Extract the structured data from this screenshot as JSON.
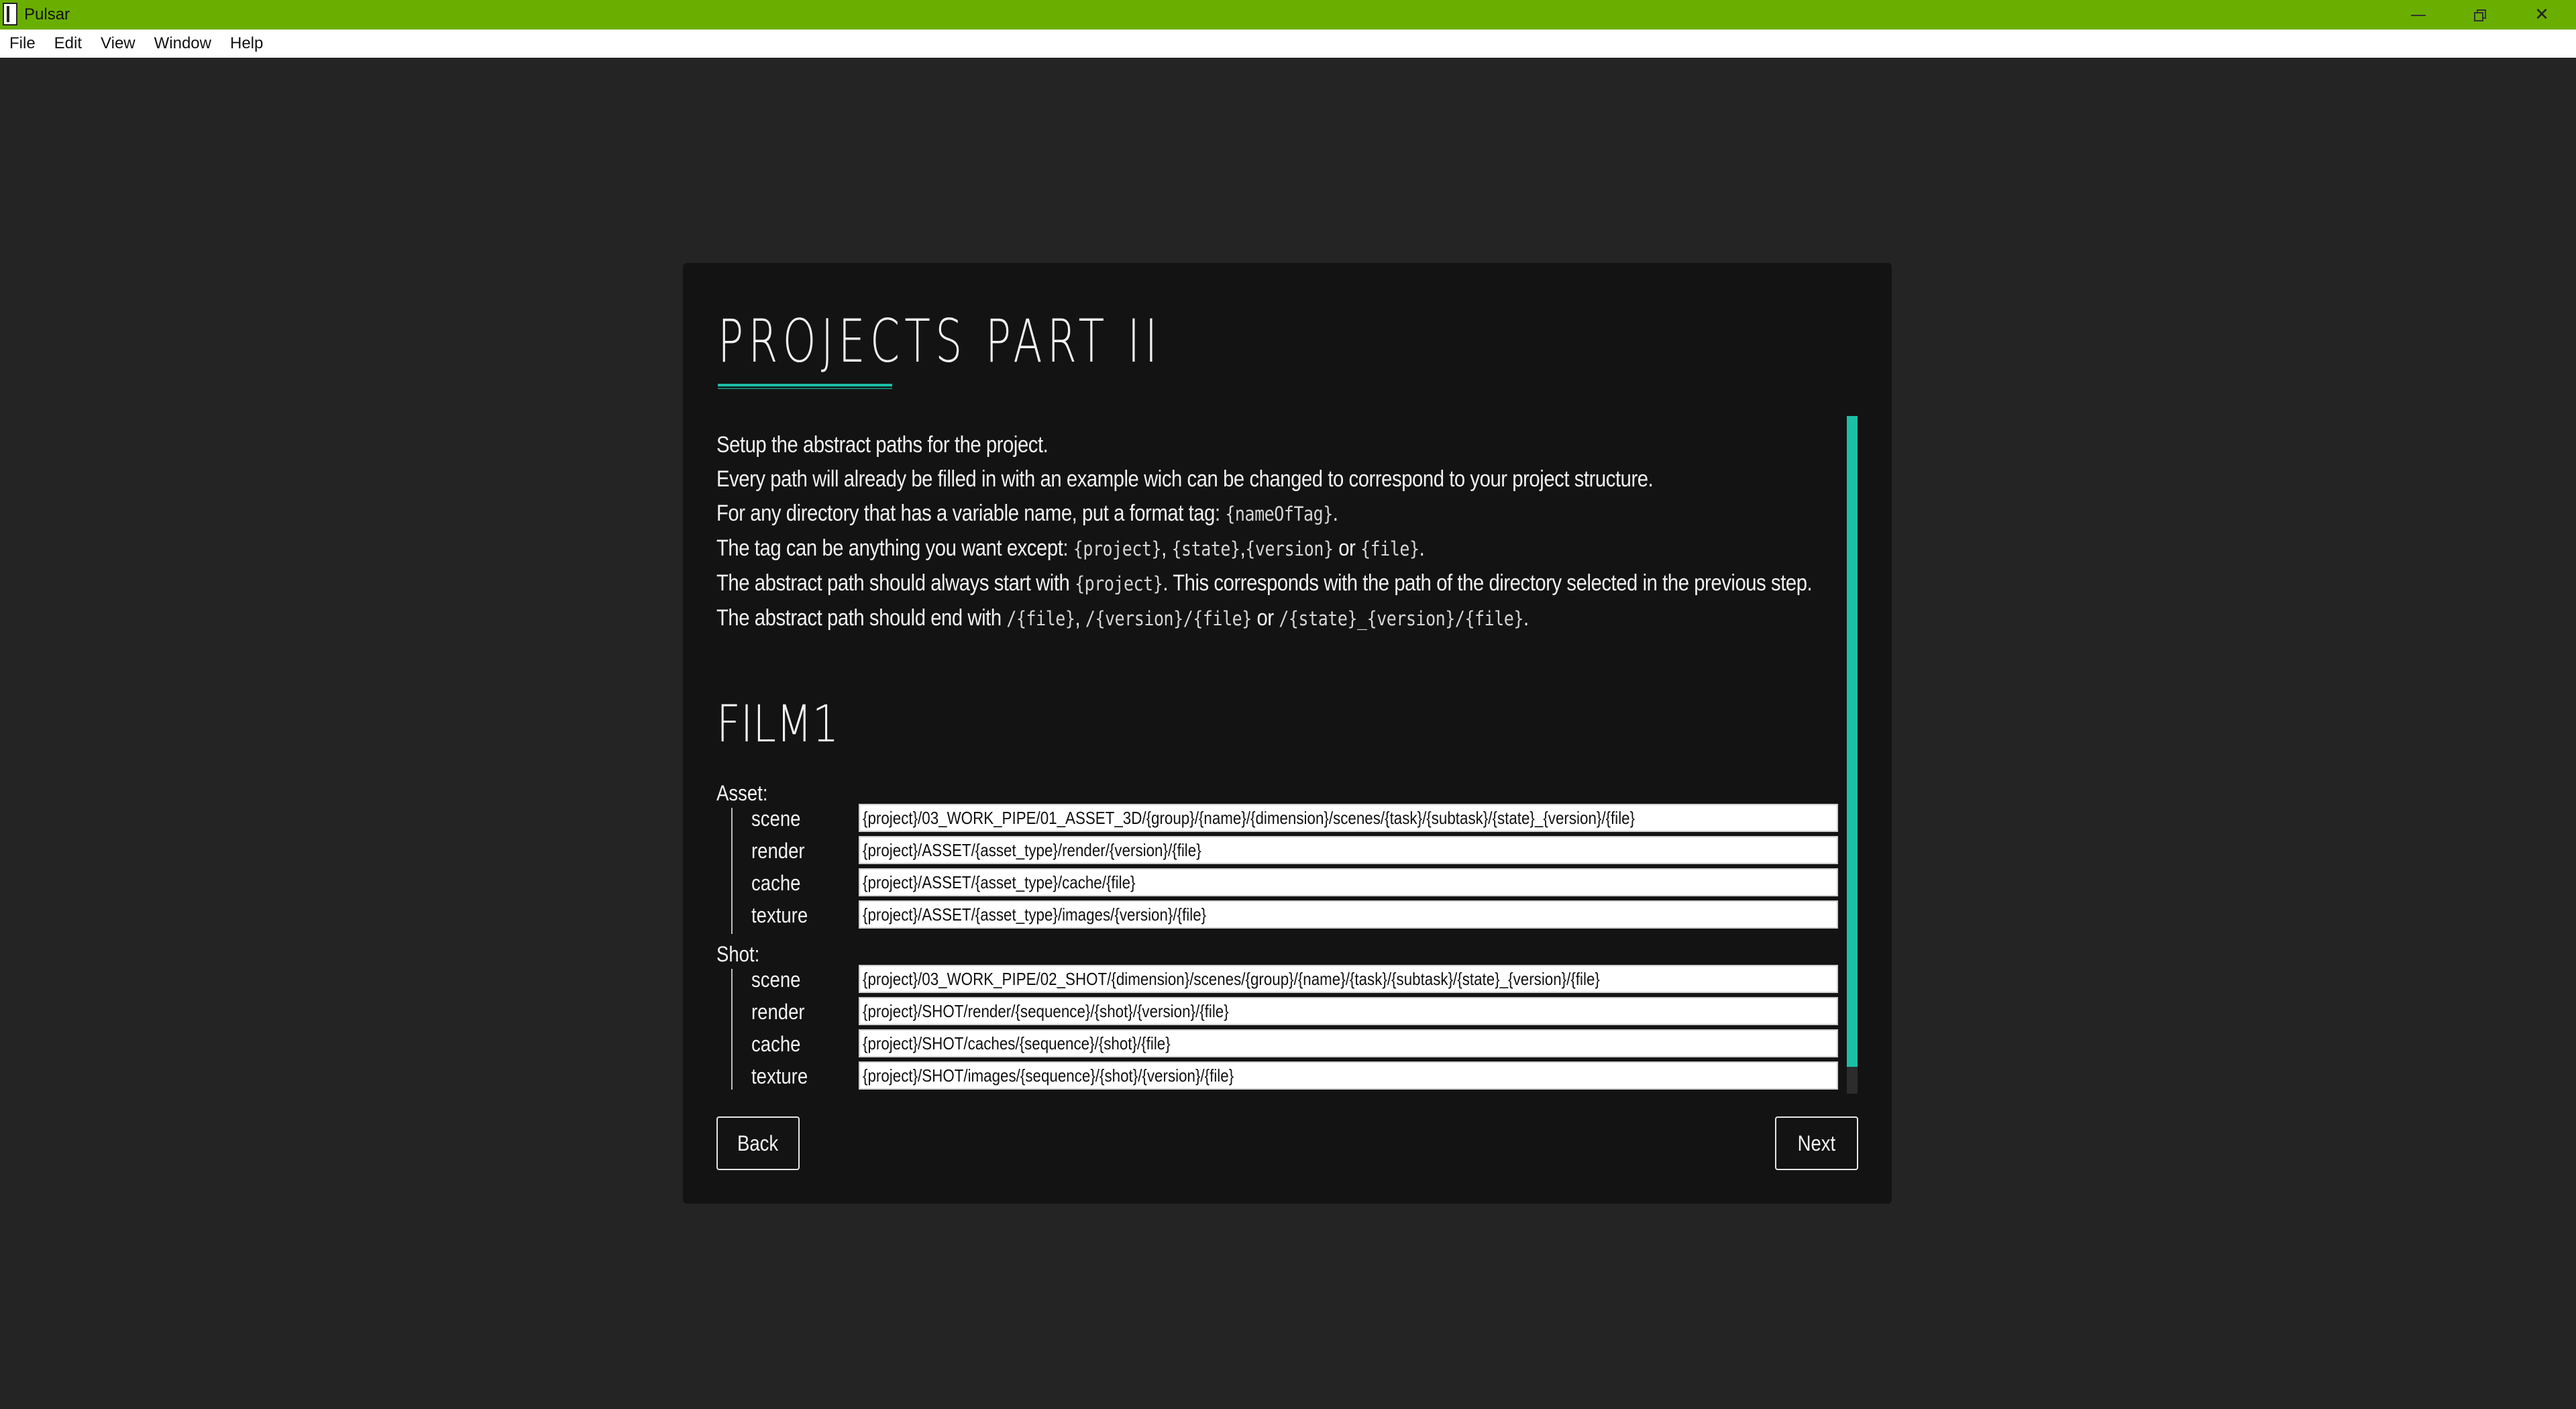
{
  "window": {
    "title": "Pulsar",
    "minimize": "",
    "maximize": "",
    "close": "✕"
  },
  "menu": [
    "File",
    "Edit",
    "View",
    "Window",
    "Help"
  ],
  "dialog": {
    "heading": "PROJECTS PART II",
    "description": [
      [
        {
          "t": "Setup the abstract paths for the project."
        }
      ],
      [
        {
          "t": "Every path will already be filled in with an example wich can be changed to correspond to your project structure."
        }
      ],
      [
        {
          "t": "For any directory that has a variable name, put a format tag: "
        },
        {
          "t": "{nameOfTag}",
          "m": true
        },
        {
          "t": "."
        }
      ],
      [
        {
          "t": "The tag can be anything you want except: "
        },
        {
          "t": "{project}",
          "m": true
        },
        {
          "t": ", "
        },
        {
          "t": "{state}",
          "m": true
        },
        {
          "t": ","
        },
        {
          "t": "{version}",
          "m": true
        },
        {
          "t": " or "
        },
        {
          "t": "{file}",
          "m": true
        },
        {
          "t": "."
        }
      ],
      [
        {
          "t": "The abstract path should always start with "
        },
        {
          "t": "{project}",
          "m": true
        },
        {
          "t": ". This corresponds with the path of the directory selected in the previous step."
        }
      ],
      [
        {
          "t": "The abstract path should end with "
        },
        {
          "t": "/{file}",
          "m": true
        },
        {
          "t": ", "
        },
        {
          "t": "/{version}/{file}",
          "m": true
        },
        {
          "t": " or "
        },
        {
          "t": "/{state}_{version}/{file}",
          "m": true
        },
        {
          "t": "."
        }
      ]
    ],
    "project_name": "FILM1",
    "sections": [
      {
        "label": "Asset:",
        "paths": [
          {
            "label": "scene",
            "value": "{project}/03_WORK_PIPE/01_ASSET_3D/{group}/{name}/{dimension}/scenes/{task}/{subtask}/{state}_{version}/{file}"
          },
          {
            "label": "render",
            "value": "{project}/ASSET/{asset_type}/render/{version}/{file}"
          },
          {
            "label": "cache",
            "value": "{project}/ASSET/{asset_type}/cache/{file}"
          },
          {
            "label": "texture",
            "value": "{project}/ASSET/{asset_type}/images/{version}/{file}"
          }
        ]
      },
      {
        "label": "Shot:",
        "paths": [
          {
            "label": "scene",
            "value": "{project}/03_WORK_PIPE/02_SHOT/{dimension}/scenes/{group}/{name}/{task}/{subtask}/{state}_{version}/{file}"
          },
          {
            "label": "render",
            "value": "{project}/SHOT/render/{sequence}/{shot}/{version}/{file}"
          },
          {
            "label": "cache",
            "value": "{project}/SHOT/caches/{sequence}/{shot}/{file}"
          },
          {
            "label": "texture",
            "value": "{project}/SHOT/images/{sequence}/{shot}/{version}/{file}"
          }
        ]
      }
    ],
    "back_label": "Back",
    "next_label": "Next"
  },
  "colors": {
    "titlebar": "#6aaf00",
    "accent": "#1bbfa8",
    "dialog_bg": "#131313",
    "window_bg": "#242424"
  }
}
